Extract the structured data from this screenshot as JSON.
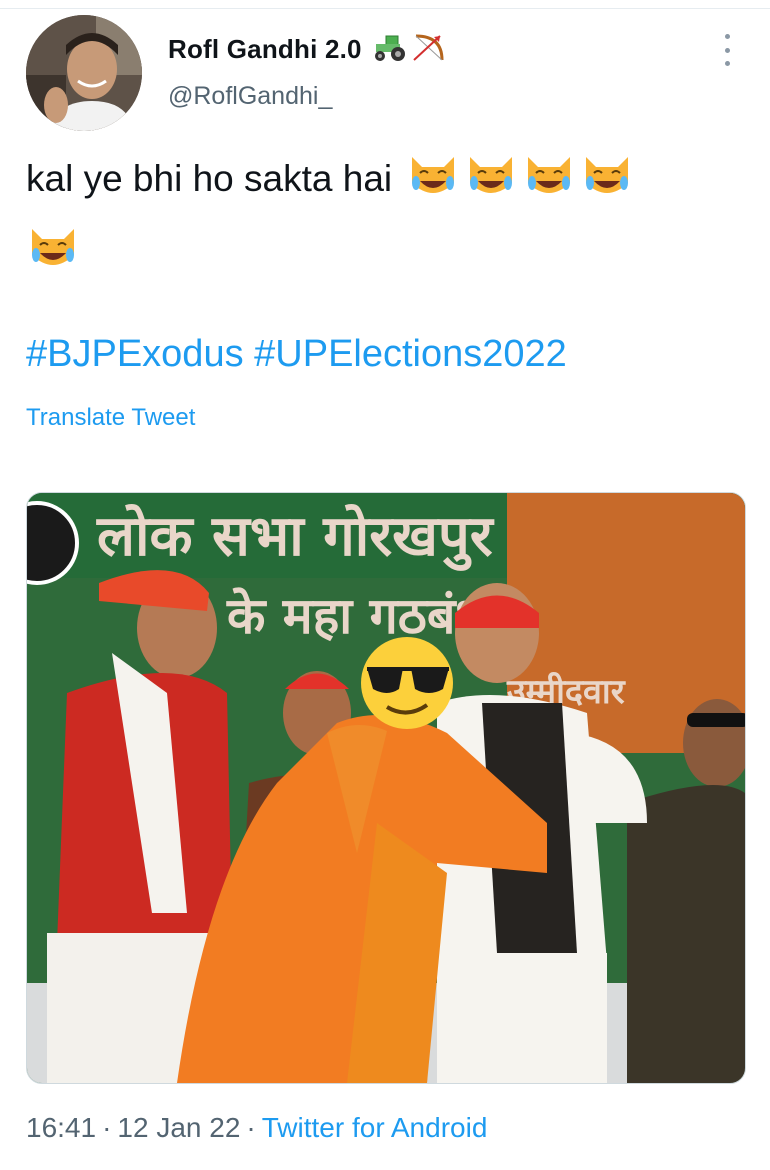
{
  "tweet": {
    "display_name": "Rofl Gandhi 2.0",
    "name_emoji": [
      "tractor-emoji",
      "bow-and-arrow-emoji"
    ],
    "handle": "@RoflGandhi_",
    "text": "kal ye bhi ho sakta hai",
    "text_emoji": [
      "cat-tears-of-joy-emoji",
      "cat-tears-of-joy-emoji",
      "cat-tears-of-joy-emoji",
      "cat-tears-of-joy-emoji",
      "cat-tears-of-joy-emoji"
    ],
    "hashtags": [
      "#BJPExodus",
      "#UPElections2022"
    ],
    "translate_label": "Translate Tweet",
    "time": "16:41",
    "date": "12 Jan 22",
    "separator": "·",
    "source": "Twitter for Android"
  },
  "media": {
    "banner_text": [
      "लोक सभा गोरखपुर",
      "के महा गठबंधन",
      "उम्मीदवार"
    ],
    "overlay_emoji": "smiling-face-with-sunglasses-emoji"
  },
  "colors": {
    "link": "#1d9bf0",
    "secondary_text": "#536471",
    "primary_text": "#0f1419"
  }
}
